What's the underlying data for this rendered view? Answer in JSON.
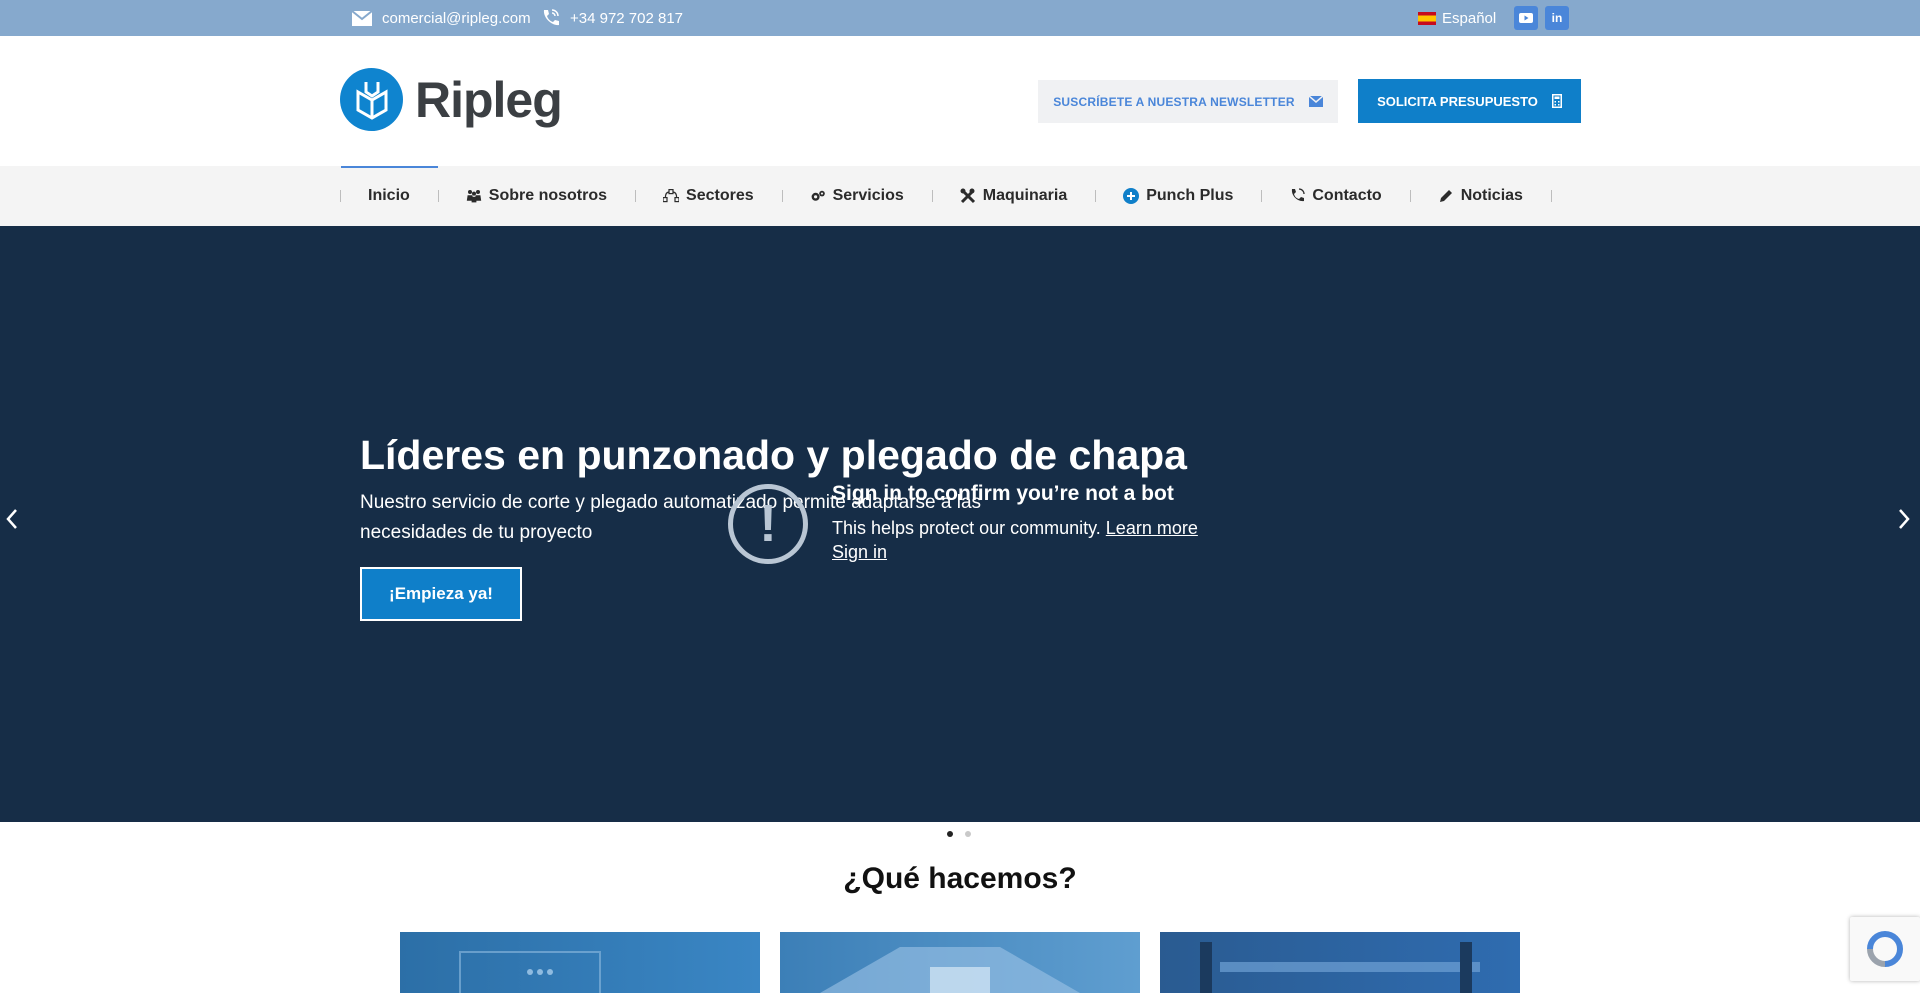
{
  "topbar": {
    "email": "comercial@ripleg.com",
    "phone": "+34 972 702 817",
    "language": "Español",
    "linkedin_label": "in"
  },
  "header": {
    "logo_text": "Ripleg",
    "newsletter_button": "SUSCRÍBETE A NUESTRA NEWSLETTER",
    "quote_button": "SOLICITA PRESUPUESTO"
  },
  "nav": {
    "items": [
      {
        "label": "Inicio",
        "icon": "none",
        "active": true
      },
      {
        "label": "Sobre nosotros",
        "icon": "people-icon"
      },
      {
        "label": "Sectores",
        "icon": "vector-icon"
      },
      {
        "label": "Servicios",
        "icon": "gears-icon"
      },
      {
        "label": "Maquinaria",
        "icon": "tools-icon"
      },
      {
        "label": "Punch Plus",
        "icon": "plus-circle-icon"
      },
      {
        "label": "Contacto",
        "icon": "phone-icon"
      },
      {
        "label": "Noticias",
        "icon": "pencil-icon"
      }
    ]
  },
  "hero": {
    "title": "Líderes en punzonado y plegado de chapa",
    "subtitle": "Nuestro servicio de corte y plegado automatizado permite adaptarse a las necesidades de tu proyecto",
    "cta": "¡Empieza ya!"
  },
  "bot_notice": {
    "title": "Sign in to confirm you’re not a bot",
    "text": "This helps protect our community.",
    "learn_more": "Learn more",
    "sign_in": "Sign in"
  },
  "section": {
    "title": "¿Qué hacemos?"
  },
  "colors": {
    "topbar": "#86a9cd",
    "primary": "#0f7fc9",
    "hero_bg": "#162d47",
    "accent": "#4a86d9"
  }
}
